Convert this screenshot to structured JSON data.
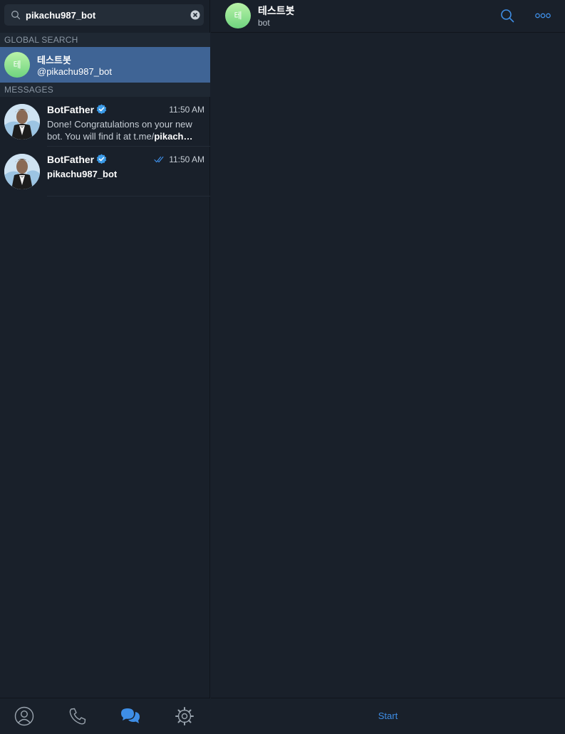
{
  "search": {
    "value": "pikachu987_bot",
    "icon": "search-icon",
    "clear_icon": "clear-icon"
  },
  "global_search": {
    "header": "GLOBAL SEARCH",
    "result": {
      "avatar_letter": "테",
      "title": "테스트봇",
      "username": "@pikachu987_bot"
    }
  },
  "messages": {
    "header": "MESSAGES",
    "items": [
      {
        "name": "BotFather",
        "time": "11:50 AM",
        "line1": "Done! Congratulations on your new",
        "line2_plain": "bot. You will find it at t.me/",
        "line2_bold": "pikach…"
      },
      {
        "name": "BotFather",
        "time": "11:50 AM",
        "text": "pikachu987_bot"
      }
    ]
  },
  "tabs": [
    {
      "icon": "contacts-icon"
    },
    {
      "icon": "calls-icon"
    },
    {
      "icon": "chats-icon"
    },
    {
      "icon": "settings-icon"
    }
  ],
  "chat_header": {
    "avatar_letter": "테",
    "title": "테스트봇",
    "subtitle": "bot"
  },
  "footer": {
    "start_label": "Start"
  },
  "colors": {
    "background": "#19202a",
    "selection": "#3f6495",
    "accent": "#3e8ee6",
    "section_header": "#1f2833"
  }
}
